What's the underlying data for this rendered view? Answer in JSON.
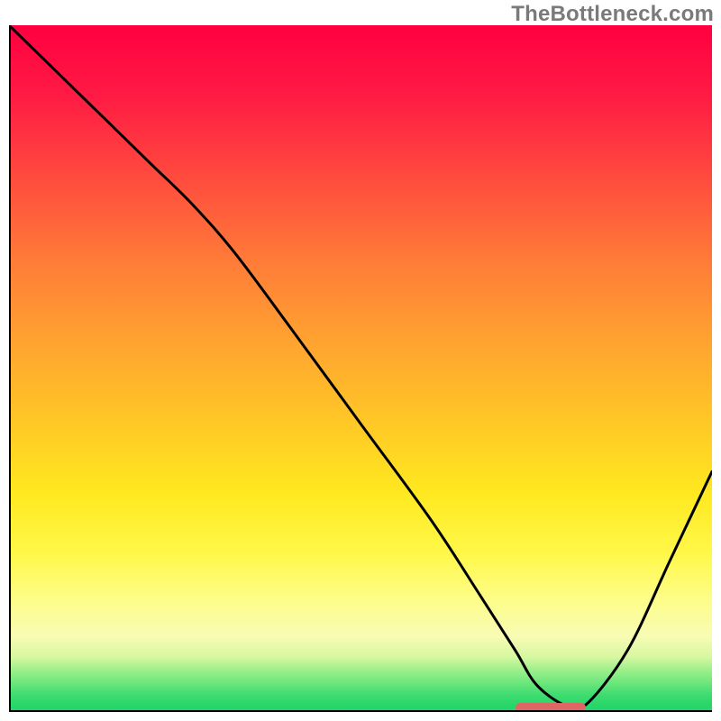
{
  "watermark": "TheBottleneck.com",
  "chart_data": {
    "type": "line",
    "title": "",
    "xlabel": "",
    "ylabel": "",
    "xlim": [
      0,
      100
    ],
    "ylim": [
      0,
      100
    ],
    "x": [
      0,
      10,
      20,
      26,
      32,
      40,
      50,
      60,
      67,
      72,
      75,
      79,
      82,
      88,
      94,
      100
    ],
    "values": [
      100,
      90,
      80,
      74,
      67,
      56,
      42,
      28,
      17,
      9,
      4,
      1,
      1,
      9,
      22,
      35
    ],
    "marker": {
      "x_start": 72,
      "x_end": 82,
      "y": 0.6
    },
    "colors": {
      "line": "#000000",
      "marker": "#e06666",
      "gradient_top": "#ff0040",
      "gradient_bottom": "#23d468"
    }
  }
}
